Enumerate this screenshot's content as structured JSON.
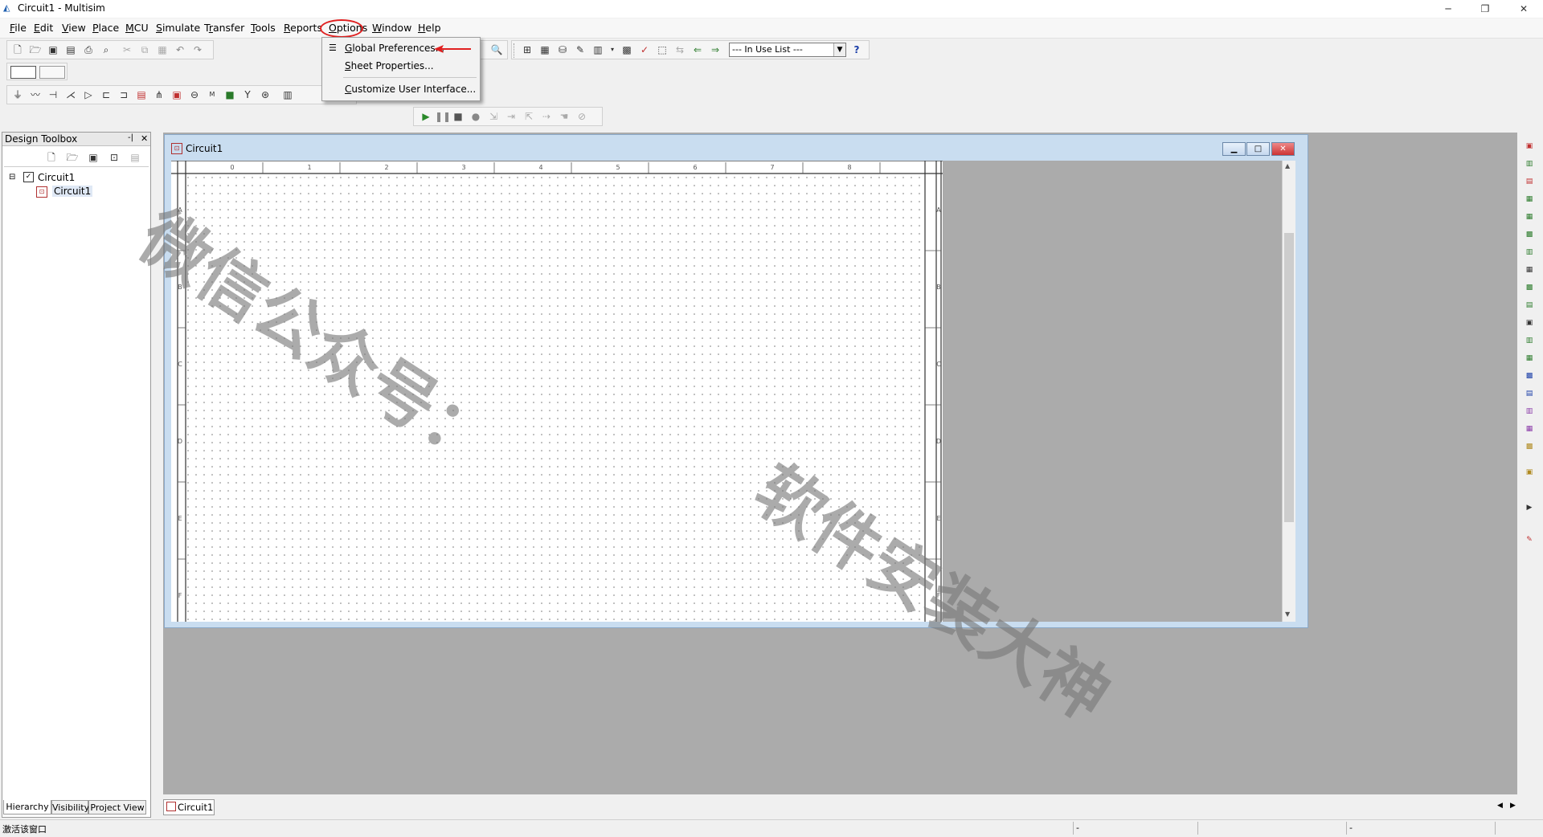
{
  "window": {
    "title": "Circuit1 - Multisim",
    "minimize": "─",
    "restore": "❐",
    "close": "✕"
  },
  "menubar": {
    "items": [
      {
        "u": "F",
        "rest": "ile"
      },
      {
        "u": "E",
        "rest": "dit"
      },
      {
        "u": "V",
        "rest": "iew"
      },
      {
        "u": "P",
        "rest": "lace"
      },
      {
        "u": "M",
        "rest": "CU"
      },
      {
        "u": "S",
        "rest": "imulate"
      },
      {
        "pre": "T",
        "u": "r",
        "rest": "ansfer"
      },
      {
        "u": "T",
        "rest": "ools"
      },
      {
        "u": "R",
        "rest": "eports"
      },
      {
        "u": "O",
        "rest": "ptions"
      },
      {
        "u": "W",
        "rest": "indow"
      },
      {
        "u": "H",
        "rest": "elp"
      }
    ]
  },
  "options_menu": {
    "items": [
      {
        "u": "G",
        "rest": "lobal Preferences..."
      },
      {
        "u": "S",
        "rest": "heet Properties..."
      },
      {
        "u": "C",
        "rest": "ustomize User Interface..."
      }
    ]
  },
  "toolbar": {
    "in_use_list": "--- In Use List ---",
    "help": "?"
  },
  "design_toolbox": {
    "title": "Design Toolbox",
    "pin": "-|",
    "close": "✕",
    "tree_root": "Circuit1",
    "tree_child": "Circuit1",
    "expander": "⊟",
    "tabs": [
      "Hierarchy",
      "Visibility",
      "Project View"
    ]
  },
  "circuit_window": {
    "title": "Circuit1",
    "min": "▁",
    "max": "□",
    "close": "✕",
    "col_labels": [
      "0",
      "1",
      "2",
      "3",
      "4",
      "5",
      "6",
      "7",
      "8"
    ],
    "row_labels": [
      "A",
      "B",
      "C",
      "D",
      "E",
      "F"
    ],
    "scroll_up": "▲",
    "scroll_down": "▼"
  },
  "doc_tab": {
    "label": "Circuit1"
  },
  "hscroll": {
    "left": "◀",
    "right": "▶"
  },
  "status": {
    "text": "激活该窗口",
    "cell1": "-",
    "cell2": "-"
  },
  "watermark": {
    "line1": "微信公众号：",
    "line2": "软件安装大神"
  },
  "colors": {
    "annotation": "#e02020",
    "workspace": "#ababab",
    "window_frame": "#c9ddf0"
  }
}
